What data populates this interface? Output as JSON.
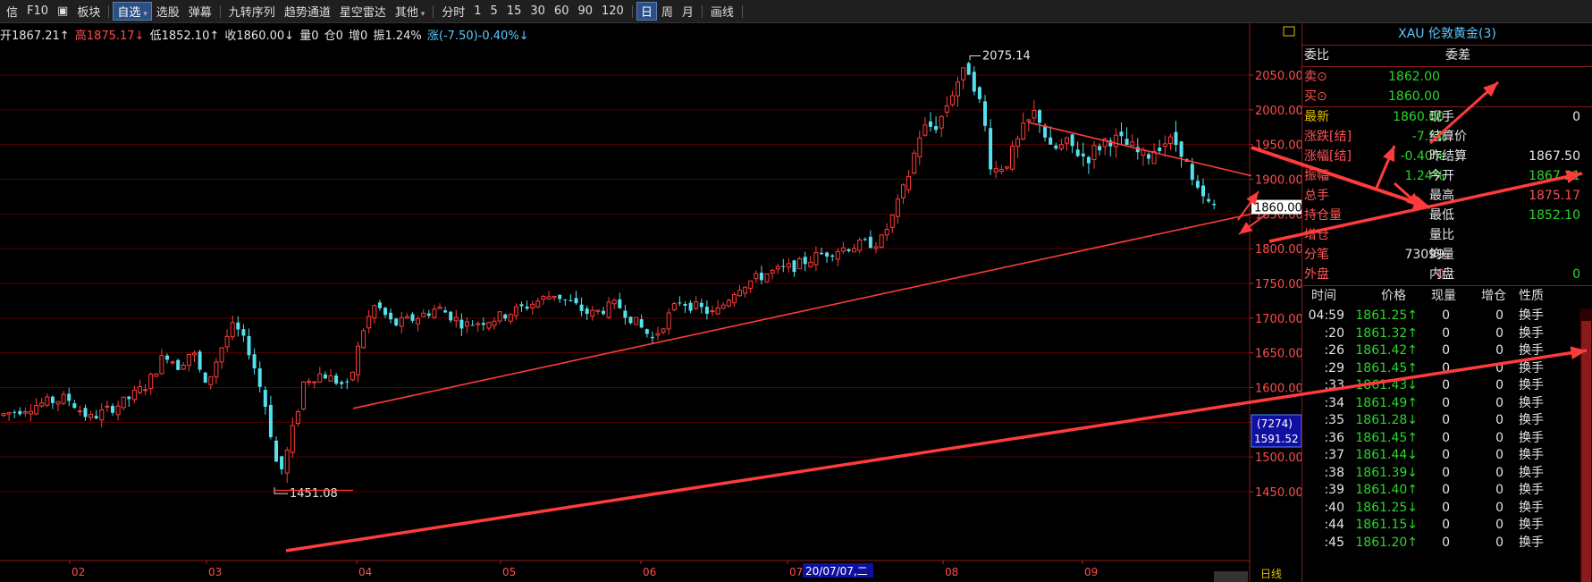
{
  "toolbar": {
    "items": [
      "信",
      "F10",
      "▣",
      "板块",
      "自选",
      "选股",
      "弹幕",
      "九转序列",
      "趋势通道",
      "星空雷达",
      "其他",
      "分时",
      "1",
      "5",
      "15",
      "30",
      "60",
      "90",
      "120",
      "日",
      "周",
      "月",
      "画线"
    ]
  },
  "infoline": {
    "open": "开1867.21↑",
    "high": "高1875.17↓",
    "low": "低1852.10↑",
    "close": "收1860.00↓",
    "vol": "量0",
    "pos": "仓0",
    "inc": "增0",
    "amp": "振1.24%",
    "chg": "涨(-7.50)-0.40%↓"
  },
  "chart_data": {
    "type": "candlestick",
    "instrument": "XAU 伦敦黄金(3)",
    "y_ticks": [
      "2050.00",
      "2000.00",
      "1950.00",
      "1900.00",
      "1850.00",
      "1800.00",
      "1750.00",
      "1700.00",
      "1650.00",
      "1600.00",
      "1550.00",
      "1500.00",
      "1450.00"
    ],
    "ylim": [
      1445,
      2100
    ],
    "x_months": [
      "02",
      "03",
      "04",
      "05",
      "06",
      "07",
      "08",
      "09"
    ],
    "annotations": {
      "high": "2075.14",
      "low": "1451.08"
    },
    "cursor_date": "20/07/07,二",
    "last_price_label": "1860.00",
    "cursor_box": {
      "vol": "(7274)",
      "price": "1591.52"
    },
    "period_label": "日线",
    "colors": {
      "up": "#ff3b3b",
      "down": "#54e1ee",
      "grid": "#5a0000",
      "trend": "#ff3b3b"
    }
  },
  "panel": {
    "title": "XAU 伦敦黄金(3)",
    "weibi": "委比",
    "weicha": "委差",
    "sell_label": "卖⊙",
    "sell_val": "1862.00",
    "buy_label": "买⊙",
    "buy_val": "1860.00",
    "rows": [
      {
        "l": "最新",
        "lv": "1860.00",
        "r": "现手",
        "rv": "0"
      },
      {
        "l": "涨跌[结]",
        "lv": "-7.50",
        "r": "结算价",
        "rv": ""
      },
      {
        "l": "涨幅[结]",
        "lv": "-0.40%",
        "r": "昨结算",
        "rv": "1867.50"
      },
      {
        "l": "振幅",
        "lv": "1.24%",
        "r": "今开",
        "rv": "1867.21"
      },
      {
        "l": "总手",
        "lv": "",
        "r": "最高",
        "rv": "1875.17"
      },
      {
        "l": "持仓量",
        "lv": "",
        "r": "最低",
        "rv": "1852.10"
      },
      {
        "l": "增仓",
        "lv": "",
        "r": "量比",
        "rv": ""
      },
      {
        "l": "分笔",
        "lv": "73099",
        "r": "均量",
        "rv": ""
      },
      {
        "l": "外盘",
        "lv": "0",
        "r": "内盘",
        "rv": "0"
      }
    ],
    "ticks_head": [
      "时间",
      "价格",
      "现量",
      "增仓",
      "性质"
    ],
    "ticks": [
      {
        "t": "04:59",
        "p": "1861.25↑",
        "v": "0",
        "z": "0",
        "n": "换手"
      },
      {
        "t": ":20",
        "p": "1861.32↑",
        "v": "0",
        "z": "0",
        "n": "换手"
      },
      {
        "t": ":26",
        "p": "1861.42↑",
        "v": "0",
        "z": "0",
        "n": "换手"
      },
      {
        "t": ":29",
        "p": "1861.45↑",
        "v": "0",
        "z": "0",
        "n": "换手"
      },
      {
        "t": ":33",
        "p": "1861.43↓",
        "v": "0",
        "z": "0",
        "n": "换手"
      },
      {
        "t": ":34",
        "p": "1861.49↑",
        "v": "0",
        "z": "0",
        "n": "换手"
      },
      {
        "t": ":35",
        "p": "1861.28↓",
        "v": "0",
        "z": "0",
        "n": "换手"
      },
      {
        "t": ":36",
        "p": "1861.45↑",
        "v": "0",
        "z": "0",
        "n": "换手"
      },
      {
        "t": ":37",
        "p": "1861.44↓",
        "v": "0",
        "z": "0",
        "n": "换手"
      },
      {
        "t": ":38",
        "p": "1861.39↓",
        "v": "0",
        "z": "0",
        "n": "换手"
      },
      {
        "t": ":39",
        "p": "1861.40↑",
        "v": "0",
        "z": "0",
        "n": "换手"
      },
      {
        "t": ":40",
        "p": "1861.25↓",
        "v": "0",
        "z": "0",
        "n": "换手"
      },
      {
        "t": ":44",
        "p": "1861.15↓",
        "v": "0",
        "z": "0",
        "n": "换手"
      },
      {
        "t": ":45",
        "p": "1861.20↑",
        "v": "0",
        "z": "0",
        "n": "换手"
      }
    ]
  }
}
